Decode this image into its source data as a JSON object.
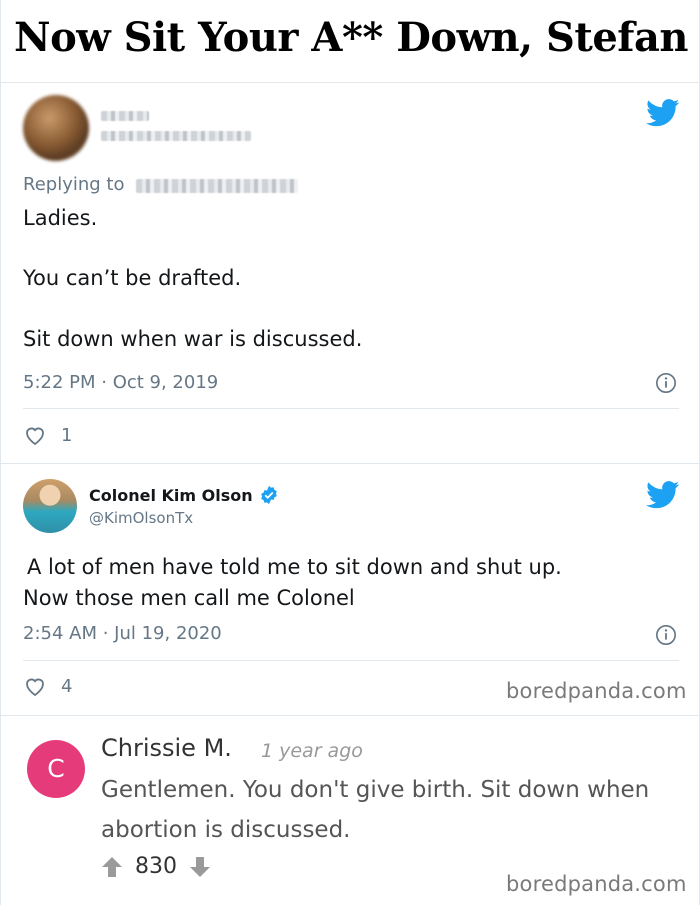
{
  "page": {
    "title": "Now Sit Your A** Down, Stefan"
  },
  "tweet1": {
    "replying_prefix": "Replying to",
    "text_lines": [
      "Ladies.",
      "You can’t be drafted.",
      "Sit down when war is discussed."
    ],
    "timestamp": "5:22 PM · Oct 9, 2019",
    "likes": "1",
    "icons": [
      "twitter-bird-icon",
      "info-icon",
      "heart-icon"
    ]
  },
  "tweet2": {
    "author_name": "Colonel Kim Olson",
    "handle": "@KimOlsonTx",
    "text_lines": [
      "A lot of men have told me to sit down and shut up.",
      "Now those men call me Colonel"
    ],
    "timestamp": "2:54 AM · Jul 19, 2020",
    "likes": "4",
    "watermark": "boredpanda.com",
    "icons": [
      "twitter-bird-icon",
      "verified-badge-icon",
      "info-icon",
      "heart-icon"
    ]
  },
  "comment": {
    "avatar_letter": "C",
    "author": "Chrissie M.",
    "time": "1 year ago",
    "text": "Gentlemen. You don't give birth. Sit down when abortion is discussed.",
    "votes": "830",
    "watermark": "boredpanda.com",
    "colors": {
      "avatar": "#e63b7a",
      "twitter_blue": "#1da1f2"
    }
  }
}
